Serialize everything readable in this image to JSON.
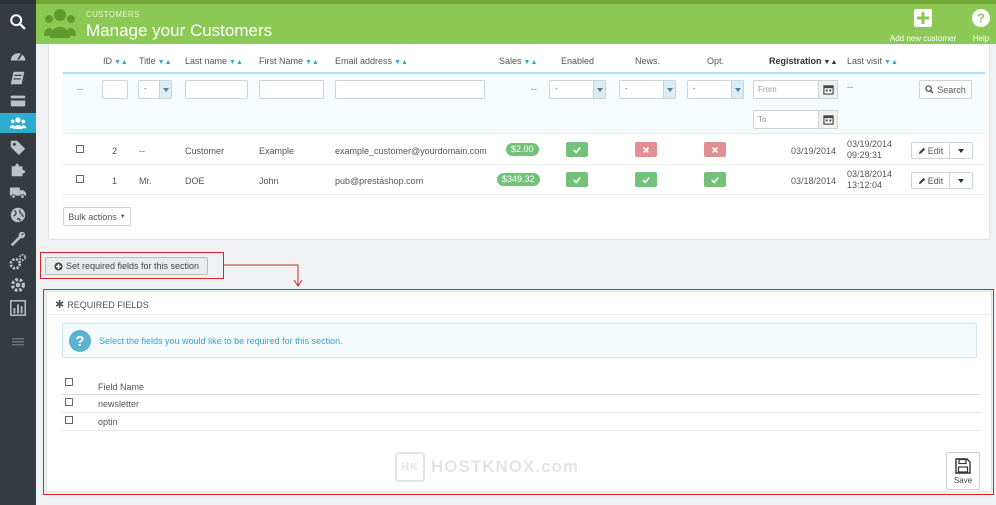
{
  "header": {
    "breadcrumb": "Customers",
    "title": "Manage your Customers",
    "add_label": "Add new customer",
    "help_label": "Help"
  },
  "sidebar": {
    "icons": [
      "search-icon",
      "dashboard-icon",
      "catalog-icon",
      "orders-icon",
      "customers-icon",
      "price-rules-icon",
      "modules-icon",
      "shipping-icon",
      "localization-icon",
      "preferences-icon",
      "advanced-parameters-icon",
      "administration-icon",
      "stats-icon"
    ],
    "active": "customers-icon"
  },
  "table": {
    "columns": {
      "id": "ID",
      "title": "Title",
      "last_name": "Last name",
      "first_name": "First Name",
      "email": "Email address",
      "sales": "Sales",
      "enabled": "Enabled",
      "news": "News.",
      "opt": "Opt.",
      "registration": "Registration",
      "last_visit": "Last visit"
    },
    "filters": {
      "dash": "--",
      "title_select": "-",
      "enabled_select": "-",
      "news_select": "-",
      "opt_select": "-",
      "from_placeholder": "From",
      "to_placeholder": "To",
      "sales_dash": "--",
      "last_visit_dash": "--",
      "search_label": "Search"
    },
    "rows": [
      {
        "id": "2",
        "title": "--",
        "last_name": "Customer",
        "first_name": "Example",
        "email": "example_customer@yourdomain.com",
        "sales": "$2.00",
        "enabled": true,
        "news": false,
        "opt": false,
        "registration": "03/19/2014",
        "last_visit_date": "03/19/2014",
        "last_visit_time": "09:29:31",
        "edit_label": "Edit"
      },
      {
        "id": "1",
        "title": "Mr.",
        "last_name": "DOE",
        "first_name": "John",
        "email": "pub@prestashop.com",
        "sales": "$349.32",
        "enabled": true,
        "news": true,
        "opt": true,
        "registration": "03/18/2014",
        "last_visit_date": "03/18/2014",
        "last_visit_time": "13:12:04",
        "edit_label": "Edit"
      }
    ],
    "bulk_actions_label": "Bulk actions"
  },
  "set_required_label": "Set required fields for this section",
  "required_fields": {
    "title": "Required Fields",
    "info": "Select the fields you would like to be required for this section.",
    "column_header": "Field Name",
    "fields": [
      "newsletter",
      "optin"
    ],
    "save_label": "Save"
  },
  "watermark": {
    "logo": "HK",
    "text": "HOSTKNOX.com"
  },
  "colors": {
    "header_green": "#8bc954",
    "sidebar_dark": "#363a41",
    "accent_blue": "#2eacce",
    "status_green": "#72c279",
    "status_red": "#e08f95",
    "annotation_red": "#d4272d"
  }
}
